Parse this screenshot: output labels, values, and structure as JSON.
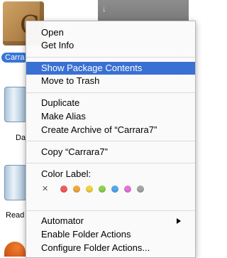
{
  "selected_item": {
    "label": "Carra"
  },
  "desktop_labels": {
    "folder1": "Da",
    "folder2": "Read"
  },
  "menu": {
    "items": {
      "open": "Open",
      "get_info": "Get Info",
      "show_package_contents": "Show Package Contents",
      "move_to_trash": "Move to Trash",
      "duplicate": "Duplicate",
      "make_alias": "Make Alias",
      "create_archive": "Create Archive of “Carrara7”",
      "copy": "Copy “Carrara7”",
      "color_label": "Color Label:",
      "automator": "Automator",
      "enable_folder_actions": "Enable Folder Actions",
      "configure_folder_actions": "Configure Folder Actions..."
    },
    "highlighted_item": "show_package_contents",
    "label_colors": [
      "#f25b5b",
      "#f3a93a",
      "#f2d33c",
      "#8ed14b",
      "#56a6f0",
      "#e574d7",
      "#a5a5a5"
    ],
    "no_label_icon": "x-icon",
    "automator_submenu_icon": "chevron-right-icon"
  },
  "colors": {
    "highlight": "#3a70d3",
    "selection": "#3875d7"
  },
  "icons": {
    "window_arrow": "↓"
  }
}
